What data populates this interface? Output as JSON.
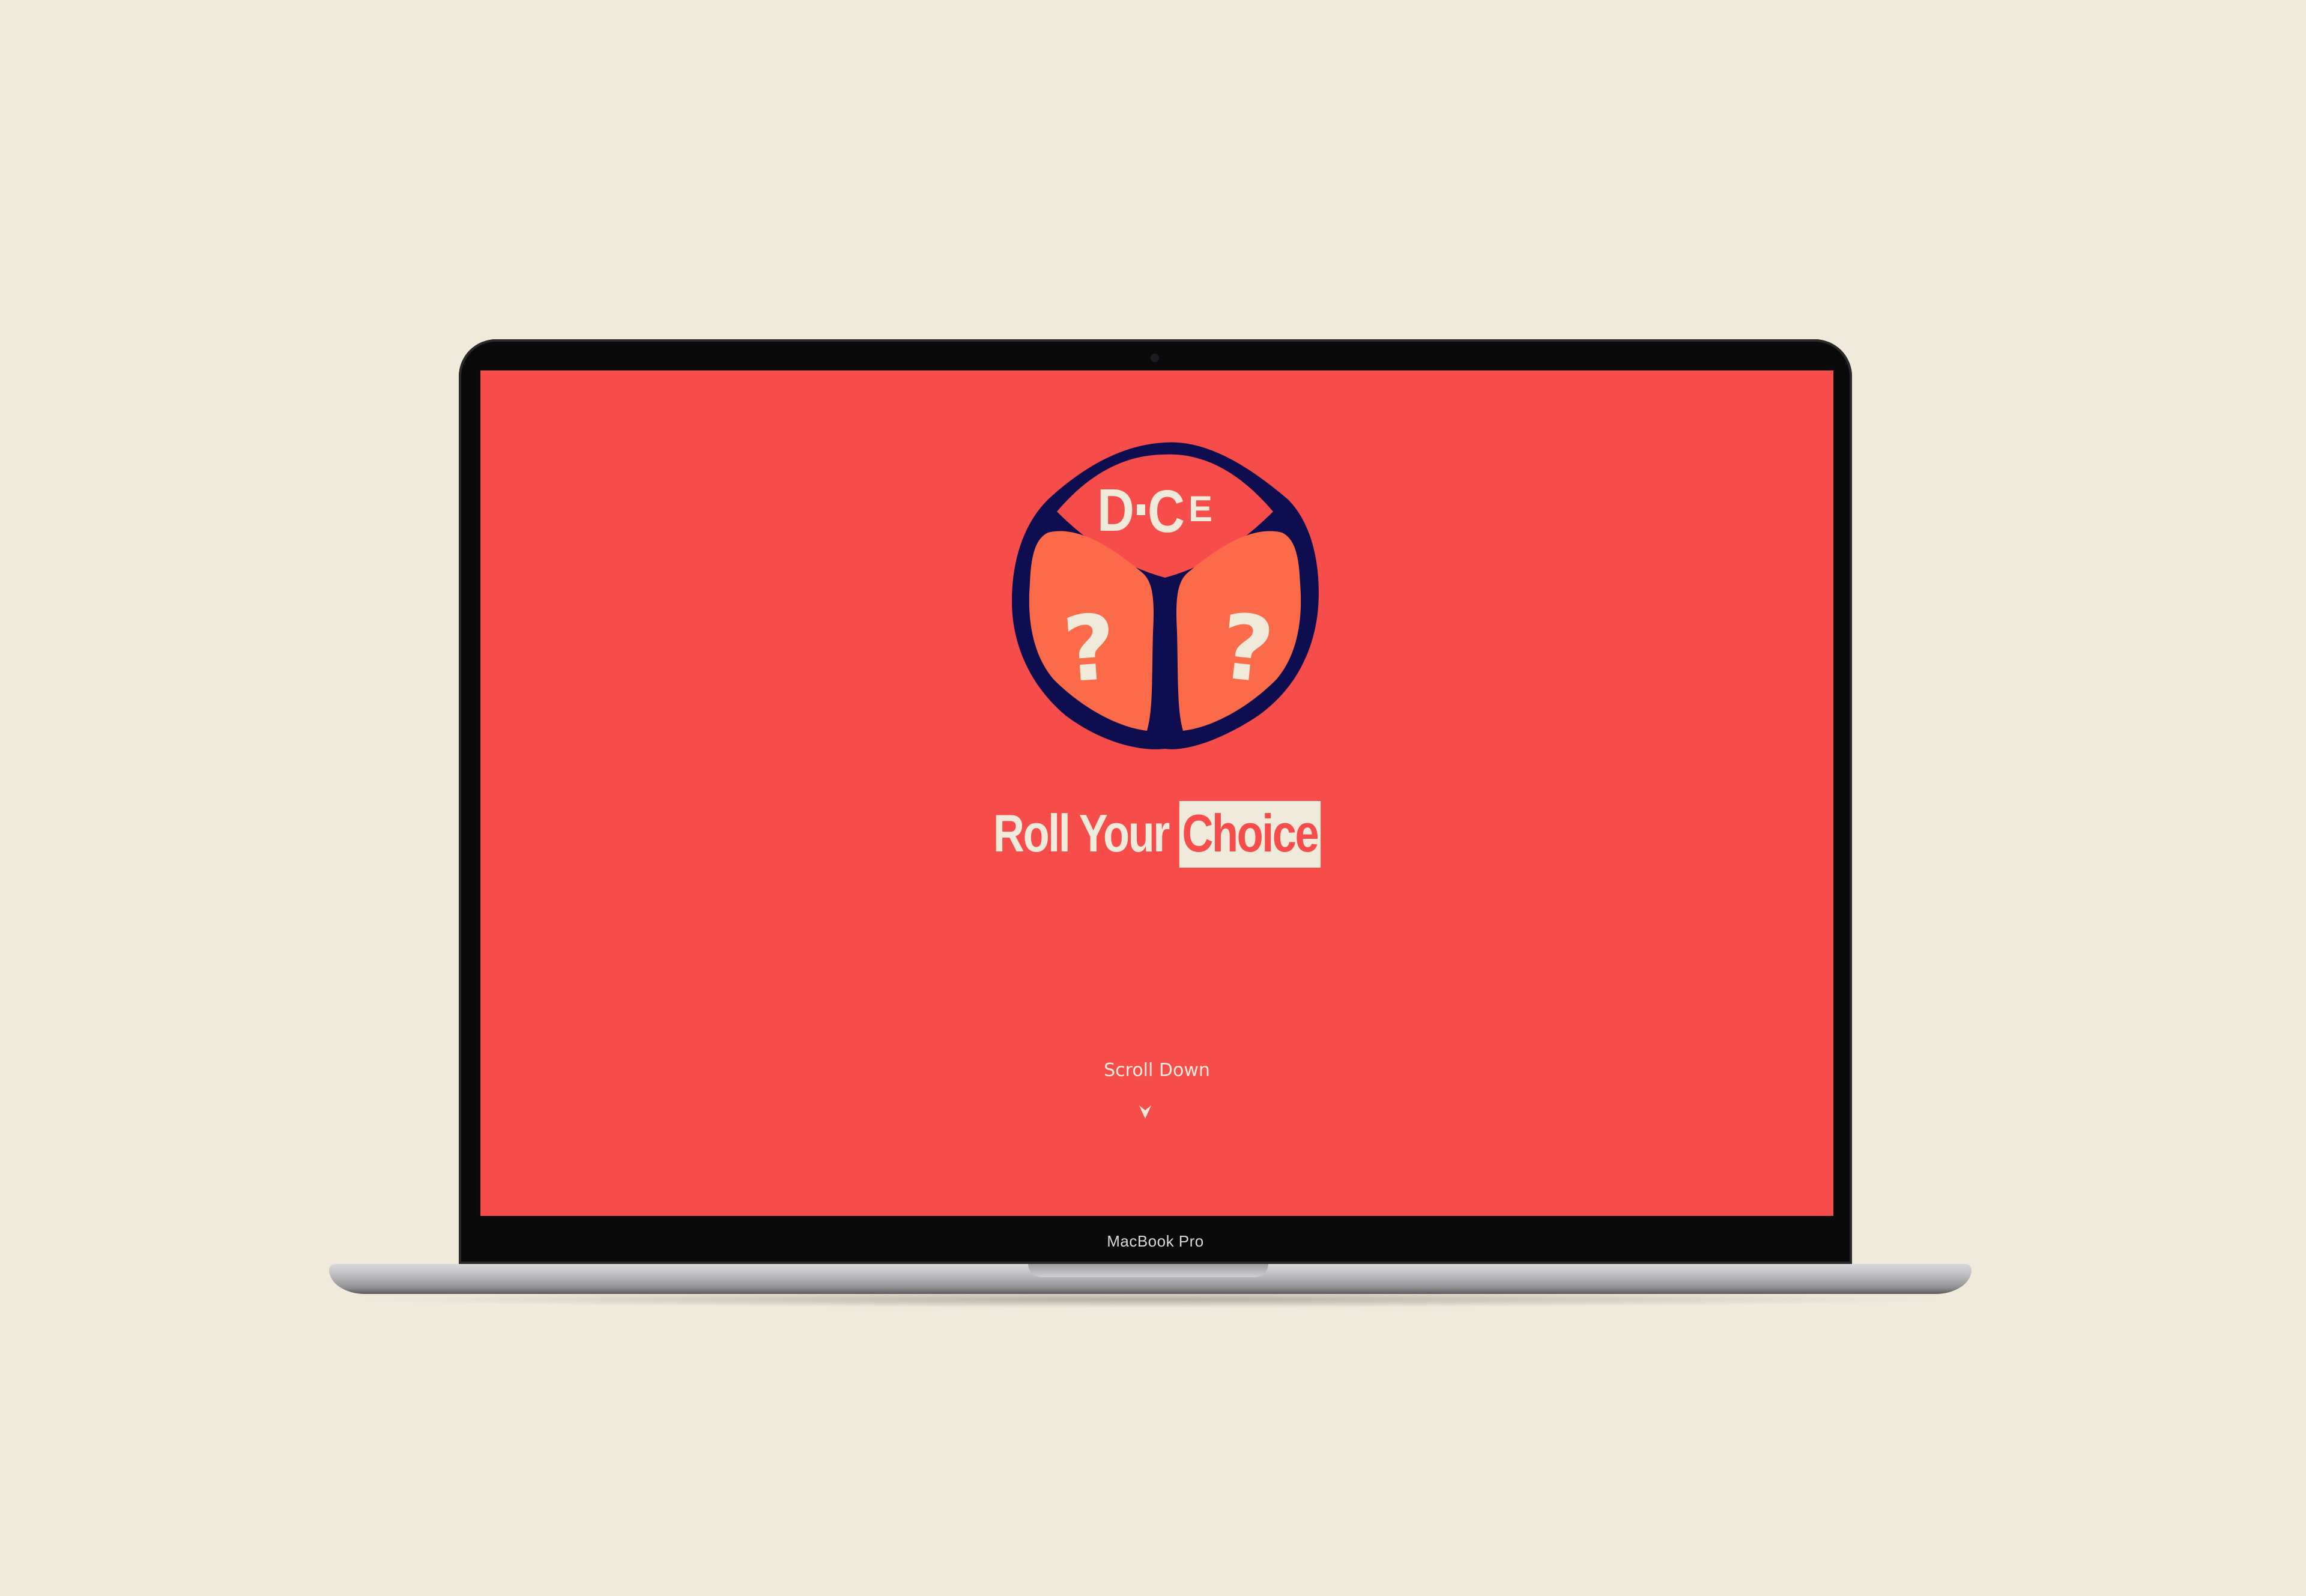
{
  "device": {
    "model_label": "MacBook Pro"
  },
  "colors": {
    "background": "#f0eadb",
    "screen": "#f64c4a",
    "die_face": "#fb6b49",
    "die_outline": "#0d0d4f",
    "text_light": "#f0eadb"
  },
  "hero": {
    "logo_text": "DICE",
    "logo_letters": [
      "D",
      "I",
      "C",
      "E"
    ],
    "face_symbol": "?",
    "tagline_part1": "Roll Your ",
    "tagline_highlight": "Choice",
    "scroll_label": "Scroll Down",
    "scroll_icon": "chevron-down-icon"
  }
}
